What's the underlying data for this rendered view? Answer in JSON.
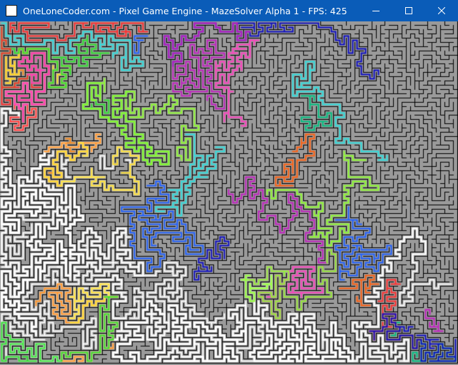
{
  "window": {
    "title": "OneLoneCoder.com - Pixel Game Engine - MazeSolver Alpha 1 - FPS: 425",
    "app_icon": "application-icon",
    "controls": [
      "minimize-icon",
      "maximize-icon",
      "close-icon"
    ]
  },
  "colors": {
    "titlebar": "#0a5cb8",
    "maze_floor": "#9a9a9a",
    "maze_wall": "#000000",
    "visited": "#ffffff",
    "paths": [
      "#ff3030",
      "#ff9020",
      "#ffe030",
      "#30e030",
      "#30e0e0",
      "#2060ff",
      "#1010c0",
      "#c020c0",
      "#ff40c0",
      "#90ff30",
      "#ff6010",
      "#00c080"
    ]
  }
}
